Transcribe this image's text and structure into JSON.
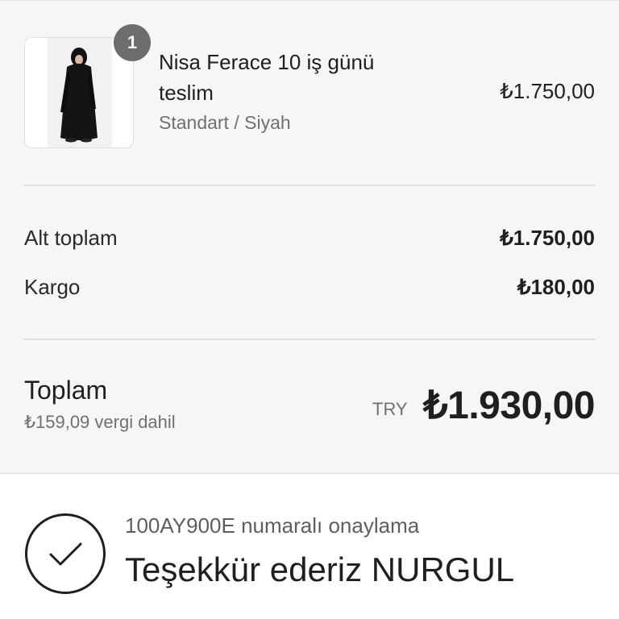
{
  "order_summary": {
    "item": {
      "name": "Nisa Ferace 10 iş günü teslim",
      "variant": "Standart / Siyah",
      "price": "₺1.750,00",
      "quantity_badge": "1",
      "image_icon": "product-photo-black-dress"
    },
    "subtotal": {
      "label": "Alt toplam",
      "value": "₺1.750,00"
    },
    "shipping": {
      "label": "Kargo",
      "value": "₺180,00"
    },
    "total": {
      "label": "Toplam",
      "tax_note": "₺159,09 vergi dahil",
      "currency": "TRY",
      "value": "₺1.930,00"
    }
  },
  "confirmation": {
    "icon": "check-circle-icon",
    "number_text": "100AY900E numaralı onaylama",
    "thanks_text": "Teşekkür ederiz NURGUL"
  },
  "colors": {
    "summary_background": "#f6f6f6",
    "badge": "#6d6d6d",
    "muted_text": "#707070",
    "text": "#1f1f1f"
  }
}
